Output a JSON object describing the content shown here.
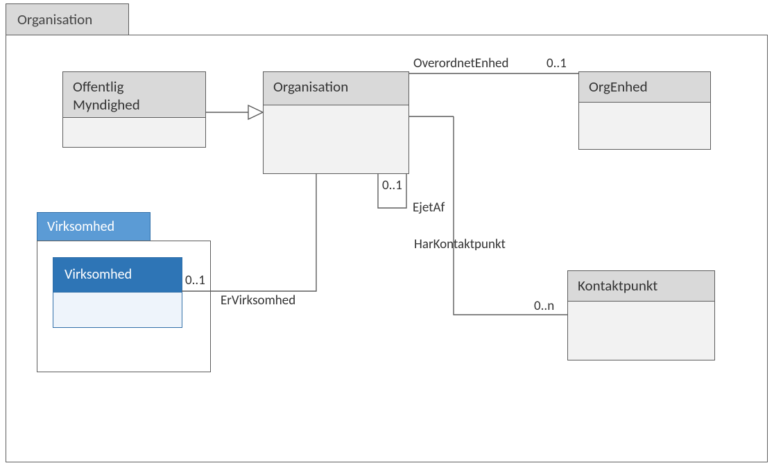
{
  "frame": {
    "title": "Organisation"
  },
  "classes": {
    "offentligMyndighed": {
      "name": "Offentlig\nMyndighed"
    },
    "organisation": {
      "name": "Organisation"
    },
    "orgEnhed": {
      "name": "OrgEnhed"
    },
    "kontaktpunkt": {
      "name": "Kontaktpunkt"
    }
  },
  "package": {
    "virksomhed": {
      "tab": "Virksomhed",
      "innerClass": "Virksomhed"
    }
  },
  "associations": {
    "overordnetEnhed": {
      "label": "OverordnetEnhed",
      "multiplicity": "0..1"
    },
    "ejetAf": {
      "label": "EjetAf",
      "multiplicity": "0..1"
    },
    "harKontaktpunkt": {
      "label": "HarKontaktpunkt",
      "multiplicity": "0..n"
    },
    "erVirksomhed": {
      "label": "ErVirksomhed",
      "multiplicity": "0..1"
    }
  },
  "colors": {
    "grayFill": "#d9d9d9",
    "lightFill": "#f2f2f2",
    "blueFill": "#2e75b6",
    "blueTab": "#5b9bd5",
    "border": "#5c5c5c"
  }
}
